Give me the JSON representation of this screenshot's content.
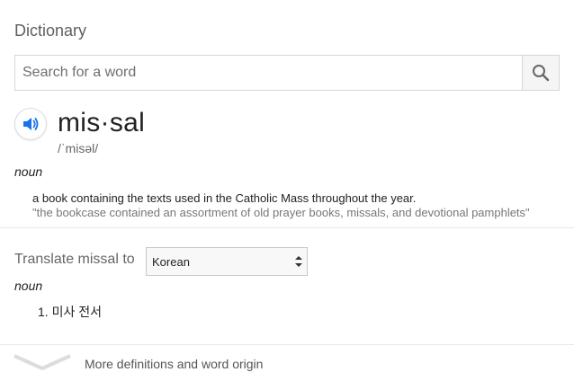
{
  "header": {
    "title": "Dictionary"
  },
  "search": {
    "placeholder": "Search for a word"
  },
  "entry": {
    "word": "mis·sal",
    "phonetic": "/ˈmisəl/",
    "part_of_speech": "noun",
    "definition": "a book containing the texts used in the Catholic Mass throughout the year.",
    "example": "\"the bookcase contained an assortment of old prayer books, missals, and devotional pamphlets\""
  },
  "translate": {
    "label": "Translate missal to",
    "selected_language": "Korean",
    "part_of_speech": "noun",
    "items": [
      {
        "text": "1. 미사 전서"
      }
    ]
  },
  "more": {
    "label": "More definitions and word origin"
  },
  "colors": {
    "speaker_accent": "#1a73e8",
    "divider": "#e8e8e8"
  }
}
